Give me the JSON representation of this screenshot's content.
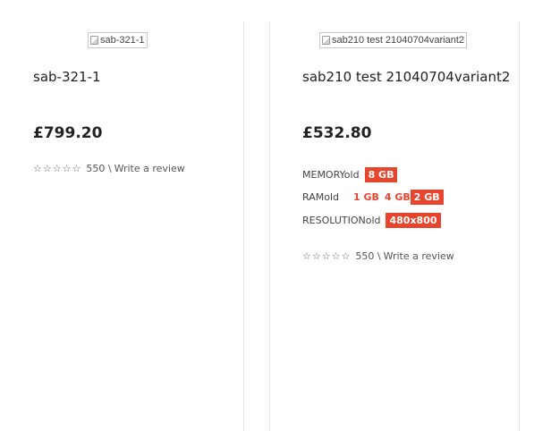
{
  "products": [
    {
      "image_alt": "sab-321-1",
      "name": "sab-321-1",
      "price": "£799.20",
      "rating": {
        "stars": 0,
        "max": 5,
        "count_text": "550 \\",
        "review_link": "Write a review"
      }
    },
    {
      "image_alt": "sab210 test 21040704variant2",
      "name": "sab210 test 21040704variant2",
      "price": "£532.80",
      "options": [
        {
          "label": "MEMORYold",
          "values": [
            {
              "text": "8 GB",
              "selected": true
            }
          ]
        },
        {
          "label": "RAMold",
          "values": [
            {
              "text": "1 GB",
              "selected": false
            },
            {
              "text": "4 GB",
              "selected": false
            },
            {
              "text": "2 GB",
              "selected": true
            }
          ]
        },
        {
          "label": "RESOLUTIONold",
          "values": [
            {
              "text": "480x800",
              "selected": true
            }
          ]
        }
      ],
      "rating": {
        "stars": 0,
        "max": 5,
        "count_text": "550 \\",
        "review_link": "Write a review"
      }
    }
  ],
  "colors": {
    "accent": "#e8452f",
    "divider": "#e6e6e6",
    "text": "#222222"
  },
  "icons": {
    "star": "star-outline-icon",
    "broken_image": "broken-image-icon"
  }
}
